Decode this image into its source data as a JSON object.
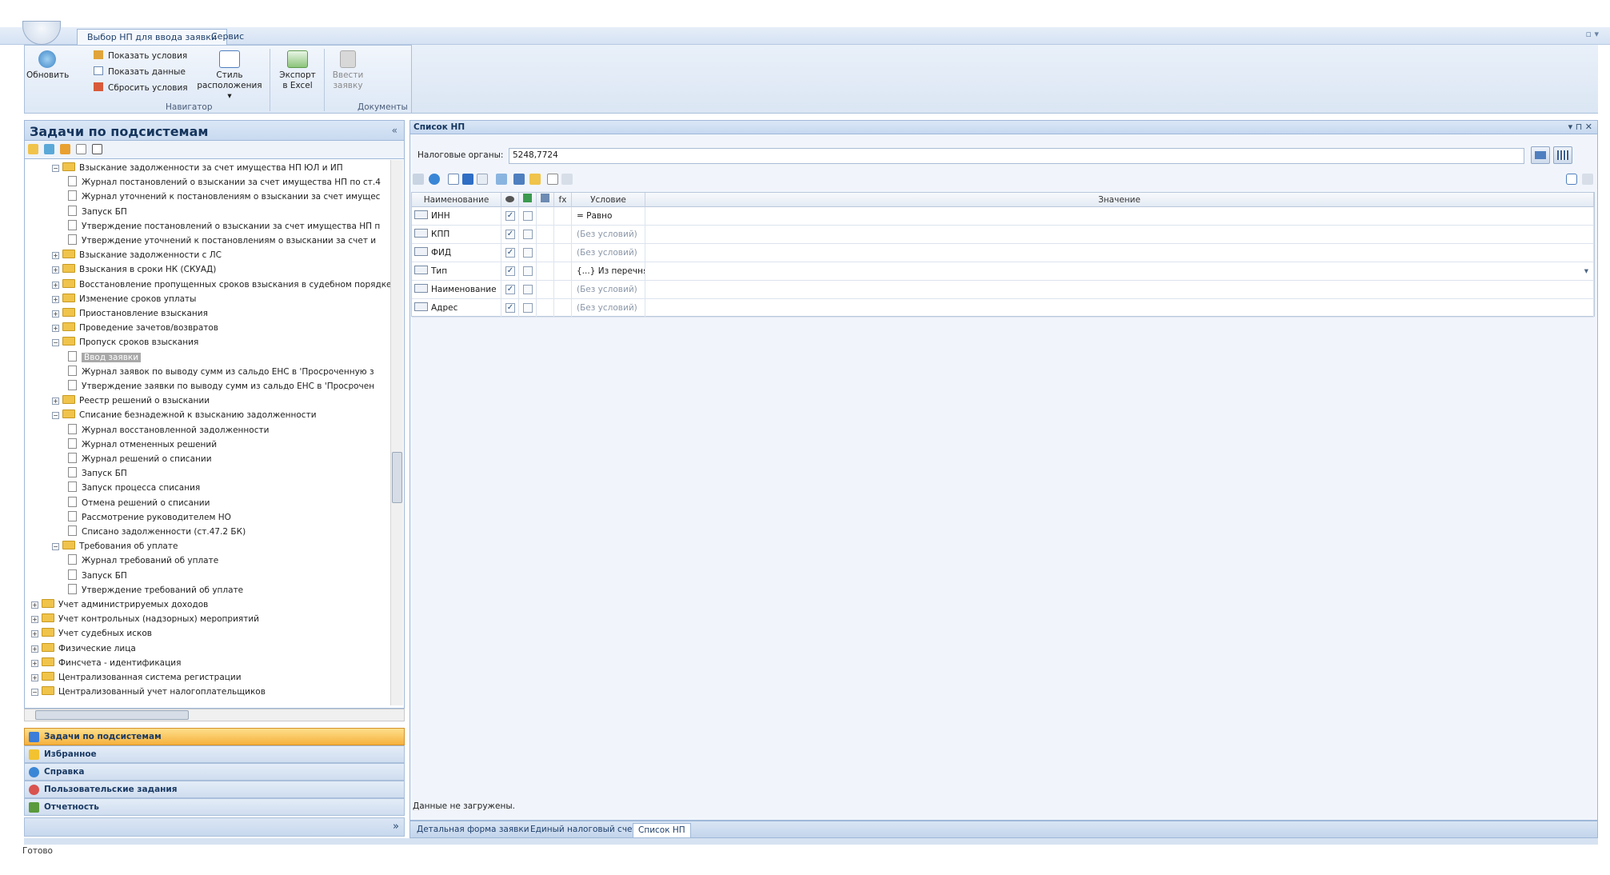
{
  "ribbon": {
    "tabs": [
      "Выбор НП для ввода заявки",
      "Сервис"
    ],
    "refresh_label": "Обновить",
    "show_conditions": "Показать условия",
    "show_data": "Показать данные",
    "reset_conditions": "Сбросить условия",
    "style_label_1": "Стиль",
    "style_label_2": "расположения ▾",
    "export_label_1": "Экспорт",
    "export_label_2": "в Excel",
    "enter_label_1": "Ввести",
    "enter_label_2": "заявку",
    "group_navigator": "Навигатор",
    "group_documents": "Документы"
  },
  "left_panel": {
    "title": "Задачи по подсистемам",
    "collapse": "«",
    "tree": [
      {
        "level": 2,
        "type": "folder",
        "expanded": true,
        "label": "Взыскание задолженности за счет имущества НП ЮЛ и ИП"
      },
      {
        "level": 3,
        "type": "doc",
        "label": "Журнал постановлений о взыскании за счет имущества НП по ст.4"
      },
      {
        "level": 3,
        "type": "doc",
        "label": "Журнал уточнений к постановлениям о взыскании за счет имущес"
      },
      {
        "level": 3,
        "type": "doc",
        "label": "Запуск БП"
      },
      {
        "level": 3,
        "type": "doc",
        "label": "Утверждение постановлений о взыскании за счет имущества НП п"
      },
      {
        "level": 3,
        "type": "doc",
        "label": "Утверждение уточнений к постановлениям о взыскании за счет и"
      },
      {
        "level": 2,
        "type": "folder",
        "expanded": false,
        "label": "Взыскание задолженности с ЛС"
      },
      {
        "level": 2,
        "type": "folder",
        "expanded": false,
        "label": "Взыскания в сроки НК (СКУАД)"
      },
      {
        "level": 2,
        "type": "folder",
        "expanded": false,
        "label": "Восстановление пропущенных сроков взыскания в судебном порядке"
      },
      {
        "level": 2,
        "type": "folder",
        "expanded": false,
        "label": "Изменение сроков уплаты"
      },
      {
        "level": 2,
        "type": "folder",
        "expanded": false,
        "label": "Приостановление взыскания"
      },
      {
        "level": 2,
        "type": "folder",
        "expanded": false,
        "label": "Проведение зачетов/возвратов"
      },
      {
        "level": 2,
        "type": "folder",
        "expanded": true,
        "label": "Пропуск сроков взыскания"
      },
      {
        "level": 3,
        "type": "doc",
        "selected": true,
        "label": "Ввод заявки"
      },
      {
        "level": 3,
        "type": "doc",
        "label": "Журнал заявок по выводу сумм из сальдо ЕНС в 'Просроченную з"
      },
      {
        "level": 3,
        "type": "doc",
        "label": "Утверждение заявки по выводу сумм из сальдо ЕНС в 'Просрочен"
      },
      {
        "level": 2,
        "type": "folder",
        "expanded": false,
        "label": "Реестр решений о взыскании"
      },
      {
        "level": 2,
        "type": "folder",
        "expanded": true,
        "label": "Списание безнадежной к взысканию задолженности"
      },
      {
        "level": 3,
        "type": "doc",
        "label": "Журнал восстановленной задолженности"
      },
      {
        "level": 3,
        "type": "doc",
        "label": "Журнал отмененных решений"
      },
      {
        "level": 3,
        "type": "doc",
        "label": "Журнал решений о списании"
      },
      {
        "level": 3,
        "type": "doc",
        "label": "Запуск БП"
      },
      {
        "level": 3,
        "type": "doc",
        "label": "Запуск процесса списания"
      },
      {
        "level": 3,
        "type": "doc",
        "label": "Отмена решений о списании"
      },
      {
        "level": 3,
        "type": "doc",
        "label": "Рассмотрение руководителем НО"
      },
      {
        "level": 3,
        "type": "doc",
        "label": "Списано задолженности (ст.47.2 БК)"
      },
      {
        "level": 2,
        "type": "folder",
        "expanded": true,
        "label": "Требования об уплате"
      },
      {
        "level": 3,
        "type": "doc",
        "label": "Журнал требований об уплате"
      },
      {
        "level": 3,
        "type": "doc",
        "label": "Запуск БП"
      },
      {
        "level": 3,
        "type": "doc",
        "label": "Утверждение требований об уплате"
      },
      {
        "level": 1,
        "type": "folder",
        "expanded": false,
        "label": "Учет администрируемых доходов"
      },
      {
        "level": 1,
        "type": "folder",
        "expanded": false,
        "label": "Учет контрольных (надзорных) мероприятий"
      },
      {
        "level": 1,
        "type": "folder",
        "expanded": false,
        "label": "Учет судебных исков"
      },
      {
        "level": 1,
        "type": "folder",
        "expanded": false,
        "label": "Физические лица"
      },
      {
        "level": 1,
        "type": "folder",
        "expanded": false,
        "label": "Финсчета - идентификация"
      },
      {
        "level": 1,
        "type": "folder",
        "expanded": false,
        "label": "Централизованная система регистрации"
      },
      {
        "level": 1,
        "type": "folder",
        "expanded": true,
        "label": "Централизованный учет налогоплательщиков"
      }
    ],
    "hscroll_label": "III"
  },
  "nav": {
    "items": [
      {
        "label": "Задачи по подсистемам",
        "color": "#3b7dd8"
      },
      {
        "label": "Избранное",
        "color": "#f2c230"
      },
      {
        "label": "Справка",
        "color": "#3a86d6"
      },
      {
        "label": "Пользовательские задания",
        "color": "#d9534f"
      },
      {
        "label": "Отчетность",
        "color": "#5a9a3c"
      }
    ],
    "config_glyph": "»"
  },
  "right_panel": {
    "title": "Список НП",
    "controls": "▾ ⊓ ✕",
    "org_label": "Налоговые органы:",
    "org_value": "5248,7724",
    "grid": {
      "headers": [
        "Наименование",
        "",
        "",
        "",
        "fx",
        "Условие",
        "Значение"
      ],
      "rows": [
        {
          "name": "ИНН",
          "condition": "= Равно",
          "muted": false
        },
        {
          "name": "КПП",
          "condition": "(Без условий)",
          "muted": true
        },
        {
          "name": "ФИД",
          "condition": "(Без условий)",
          "muted": true
        },
        {
          "name": "Тип",
          "condition": "{...} Из перечня",
          "muted": false
        },
        {
          "name": "Наименование",
          "condition": "(Без условий)",
          "muted": true
        },
        {
          "name": "Адрес",
          "condition": "(Без условий)",
          "muted": true
        }
      ]
    },
    "status": "Данные не загружены."
  },
  "bottom_tabs": [
    "Детальная форма заявки",
    "Единый налоговый счет",
    "Список НП"
  ],
  "statusbar": "Готово"
}
